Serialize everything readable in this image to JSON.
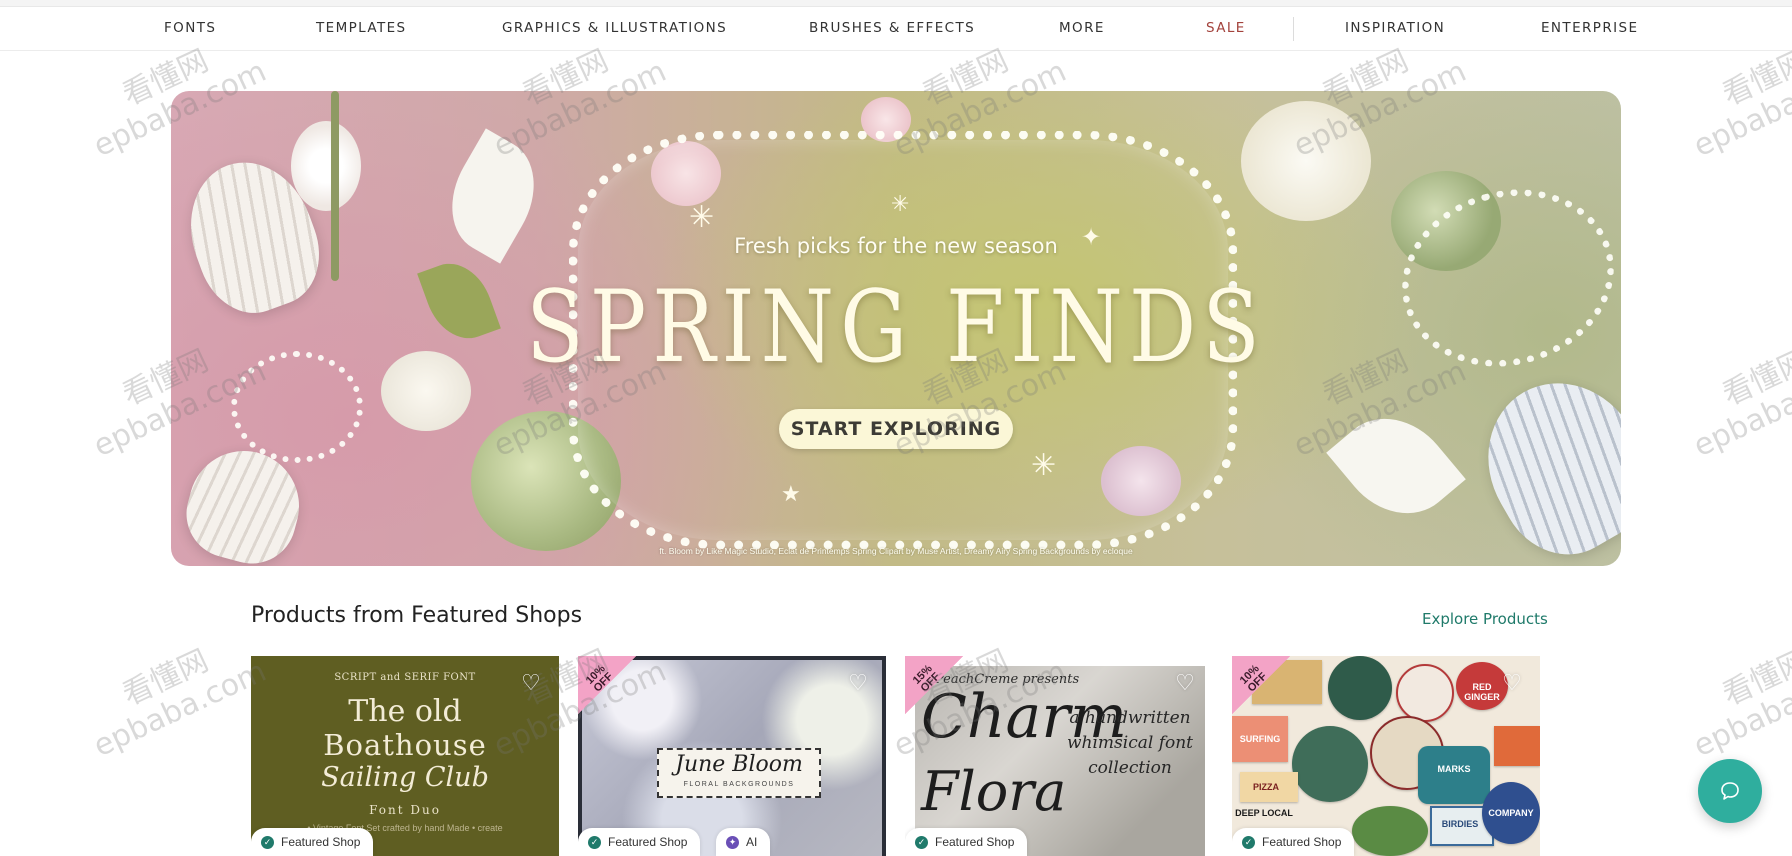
{
  "nav": {
    "items": [
      {
        "label": "FONTS"
      },
      {
        "label": "TEMPLATES"
      },
      {
        "label": "GRAPHICS & ILLUSTRATIONS"
      },
      {
        "label": "BRUSHES & EFFECTS"
      },
      {
        "label": "MORE"
      },
      {
        "label": "SALE"
      },
      {
        "label": "INSPIRATION"
      },
      {
        "label": "ENTERPRISE"
      }
    ]
  },
  "hero": {
    "subtitle": "Fresh picks for the new season",
    "title": "SPRING FINDS",
    "cta_label": "START EXPLORING",
    "credit": "ft. Bloom by Like Magic Studio, Eclat de Printemps Spring Clipart by Muse Artist, Dreamy Airy Spring Backgrounds by ecloque"
  },
  "section": {
    "title": "Products from Featured Shops",
    "explore_label": "Explore Products"
  },
  "cards": [
    {
      "badge": "",
      "pill_label": "Featured Shop",
      "art": {
        "subtitle": "SCRIPT and SERIF FONT",
        "line1": "The old",
        "line2": "Boathouse",
        "line3": "Sailing Club",
        "line4": "Font Duo",
        "line5": "• Vintage Font Set crafted by hand Made • create"
      }
    },
    {
      "badge": "10% OFF",
      "pill_label": "Featured Shop",
      "ai_label": "AI",
      "art": {
        "title": "June Bloom",
        "subtitle": "FLORAL BACKGROUNDS"
      }
    },
    {
      "badge": "15% OFF",
      "pill_label": "Featured Shop",
      "art": {
        "presenter": "PeachCreme presents",
        "word1": "Charm",
        "word2": "Flora",
        "side": "a handwritten whimsical font collection"
      }
    },
    {
      "badge": "10% OFF",
      "pill_label": "Featured Shop",
      "art": {
        "badges": [
          "PIZZA",
          "RED GINGER",
          "MARKS",
          "BIRDIES",
          "SURFING",
          "DEEP LOCAL",
          "COMPANY"
        ]
      }
    }
  ],
  "chat": {
    "icon": "chat-bubble-icon"
  },
  "watermark": {
    "line1": "看懂网",
    "line2": "epbaba.com"
  },
  "colors": {
    "accent": "#1f7a6a",
    "sale": "#a3423c",
    "chat_fab": "#2fae9e",
    "badge_pink": "#f3a3c6"
  }
}
